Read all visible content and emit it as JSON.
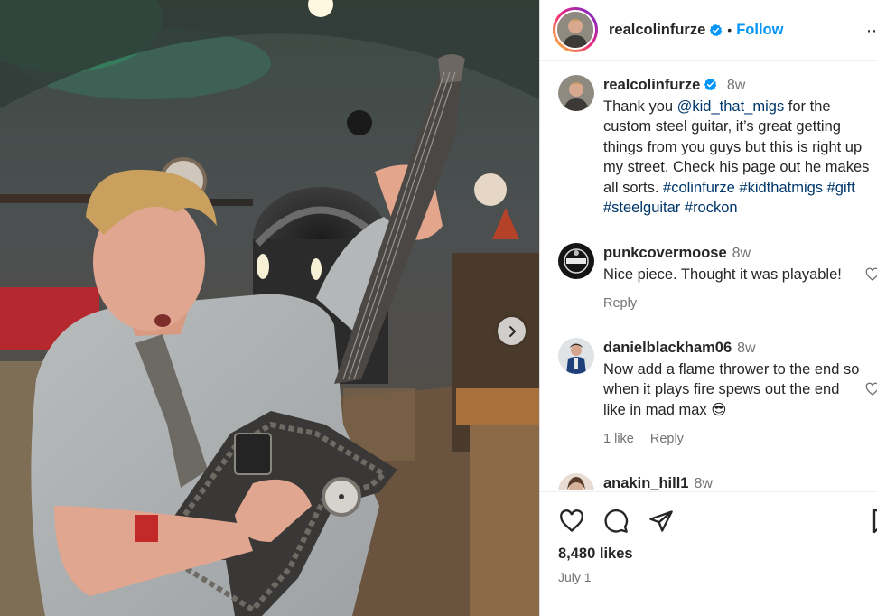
{
  "post": {
    "username": "realcolinfurze",
    "follow_label": "Follow",
    "dot": "•",
    "likes": "8,480 likes",
    "date": "July 1"
  },
  "caption": {
    "username": "realcolinfurze",
    "time": "8w",
    "text_before": "Thank you ",
    "mention": "@kid_that_migs",
    "text_after": " for the custom steel guitar, it’s great getting things from you guys but this is right up my street. Check his page out he makes all sorts. ",
    "hashtags": "#colinfurze #kidthatmigs #gift #steelguitar #rockon"
  },
  "comments": [
    {
      "username": "punkcovermoose",
      "time": "8w",
      "text": "Nice piece. Thought it was playable!",
      "reply": "Reply",
      "likes": ""
    },
    {
      "username": "danielblackham06",
      "time": "8w",
      "text": "Now add a flame thrower to the end so when it plays fire spews out the end like in mad max 😎",
      "reply": "Reply",
      "likes": "1 like"
    },
    {
      "username": "anakin_hill1",
      "time": "8w",
      "text": "",
      "reply": "",
      "likes": ""
    }
  ],
  "icons": {
    "verified": "verified-badge-icon",
    "like": "heart-icon",
    "comment": "comment-icon",
    "share": "paper-plane-icon",
    "next": "chevron-right-icon",
    "more": "more-icon"
  },
  "colors": {
    "accent": "#0095f6",
    "mention": "#00376b",
    "muted": "#737373"
  }
}
